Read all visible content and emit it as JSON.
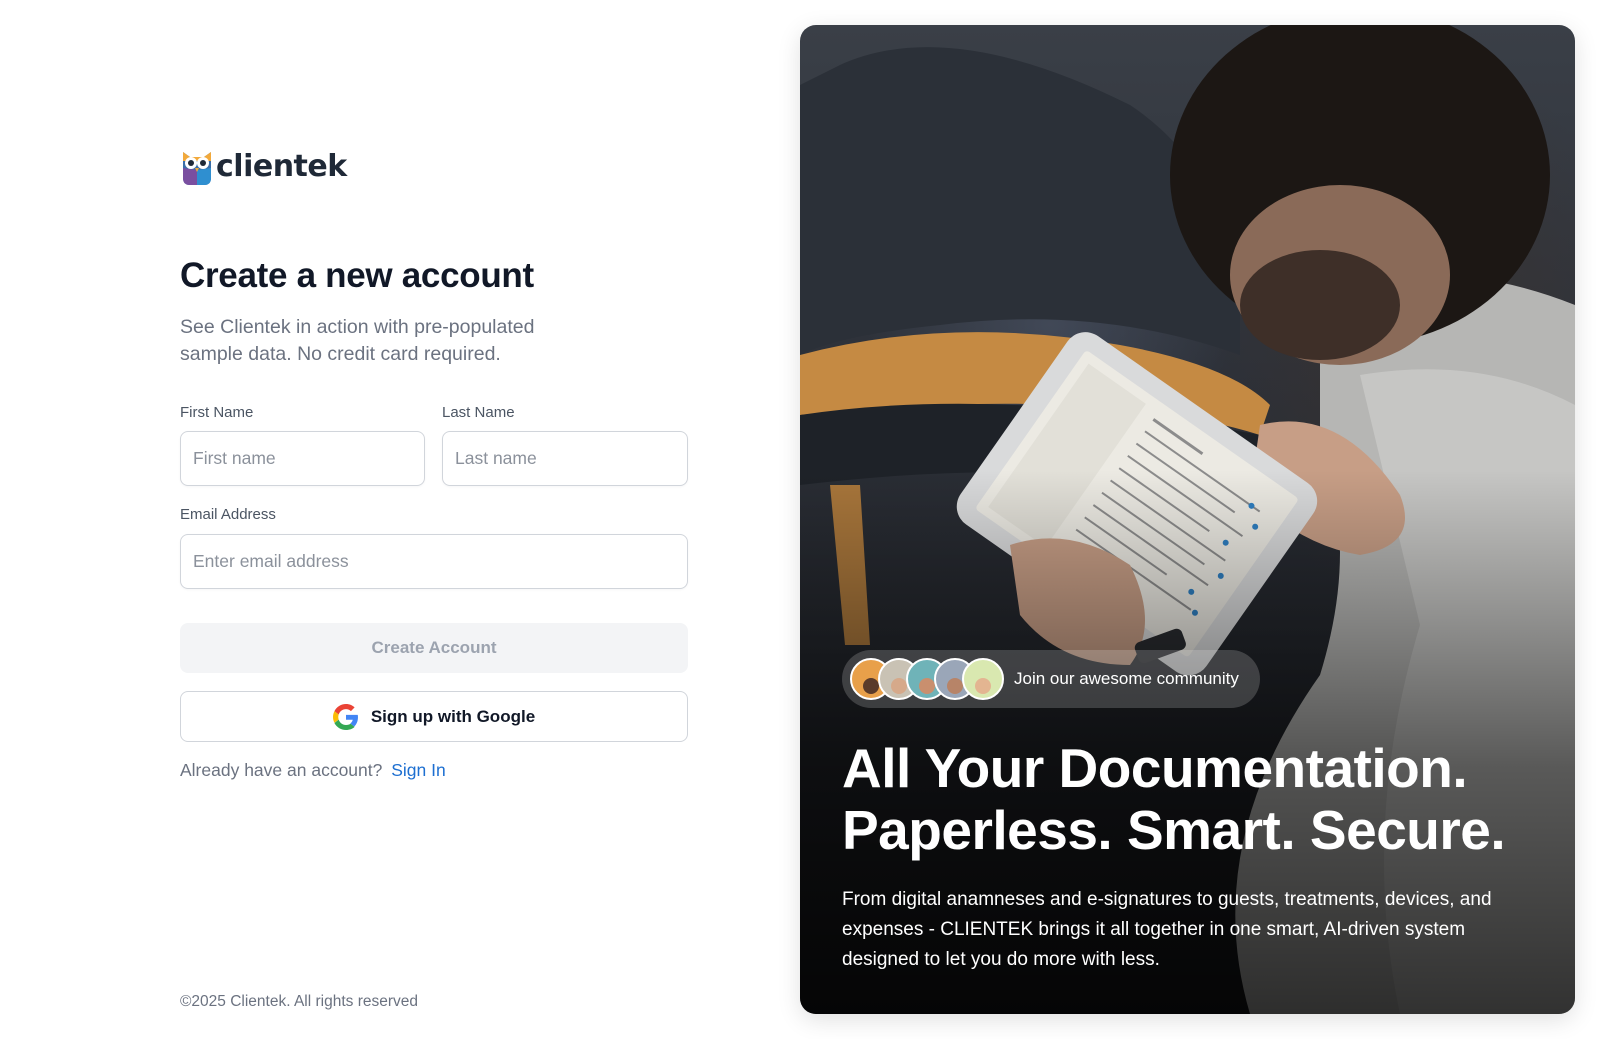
{
  "brand": {
    "name": "clientek"
  },
  "form": {
    "title": "Create a new account",
    "subtitle": "See Clientek in action with pre-populated sample data. No credit card required.",
    "first_name": {
      "label": "First Name",
      "placeholder": "First name",
      "value": ""
    },
    "last_name": {
      "label": "Last Name",
      "placeholder": "Last name",
      "value": ""
    },
    "email": {
      "label": "Email Address",
      "placeholder": "Enter email address",
      "value": ""
    },
    "create_button": "Create Account",
    "google_button": "Sign up with Google",
    "signin_prompt": "Already have an account?",
    "signin_link": "Sign In"
  },
  "footer": {
    "copyright": "©2025 Clientek. All rights reserved"
  },
  "hero": {
    "community_text": "Join our awesome community",
    "headline_line1": "All Your Documentation.",
    "headline_line2": "Paperless. Smart. Secure.",
    "description": "From digital anamneses and e-signatures to guests, treatments, devices, and expenses - CLIENTEK brings it all together in one smart, AI-driven system designed to let you do more with less.",
    "avatars": [
      {
        "name": "community-avatar-1",
        "color": "#e8a04a"
      },
      {
        "name": "community-avatar-2",
        "color": "#c9c2b4"
      },
      {
        "name": "community-avatar-3",
        "color": "#6fb3b8"
      },
      {
        "name": "community-avatar-4",
        "color": "#9aa6b8"
      },
      {
        "name": "community-avatar-5",
        "color": "#d9e8b0"
      }
    ]
  },
  "colors": {
    "link": "#1d6fd1",
    "disabled_button_bg": "#f3f4f6",
    "disabled_button_text": "#9ca3af"
  }
}
